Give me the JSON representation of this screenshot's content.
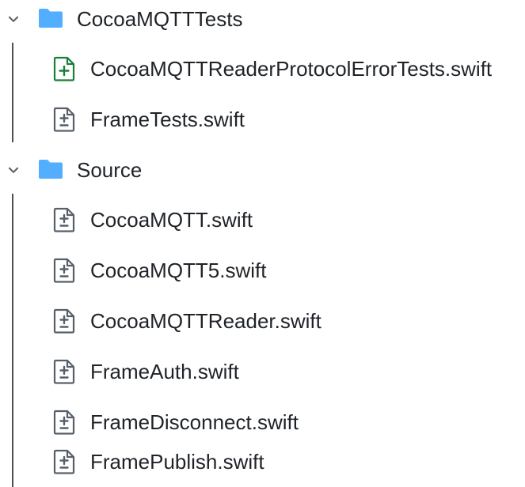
{
  "tree": {
    "directories": [
      {
        "name": "CocoaMQTTTests",
        "icon": "folder-icon",
        "expanded": true,
        "files": [
          {
            "name": "CocoaMQTTReaderProtocolErrorTests.swift",
            "status": "added",
            "icon": "file-added-icon"
          },
          {
            "name": "FrameTests.swift",
            "status": "modified",
            "icon": "file-diff-icon"
          }
        ]
      },
      {
        "name": "Source",
        "icon": "folder-icon",
        "expanded": true,
        "files": [
          {
            "name": "CocoaMQTT.swift",
            "status": "modified",
            "icon": "file-diff-icon"
          },
          {
            "name": "CocoaMQTT5.swift",
            "status": "modified",
            "icon": "file-diff-icon"
          },
          {
            "name": "CocoaMQTTReader.swift",
            "status": "modified",
            "icon": "file-diff-icon"
          },
          {
            "name": "FrameAuth.swift",
            "status": "modified",
            "icon": "file-diff-icon"
          },
          {
            "name": "FrameDisconnect.swift",
            "status": "modified",
            "icon": "file-diff-icon"
          },
          {
            "name": "FramePublish.swift",
            "status": "modified",
            "icon": "file-diff-icon"
          }
        ]
      }
    ],
    "colors": {
      "folder": "#54aeff",
      "added": "#1a7f37",
      "modified_icon": "#57606a",
      "text": "#1f2328",
      "guide": "#4b4f55"
    }
  }
}
